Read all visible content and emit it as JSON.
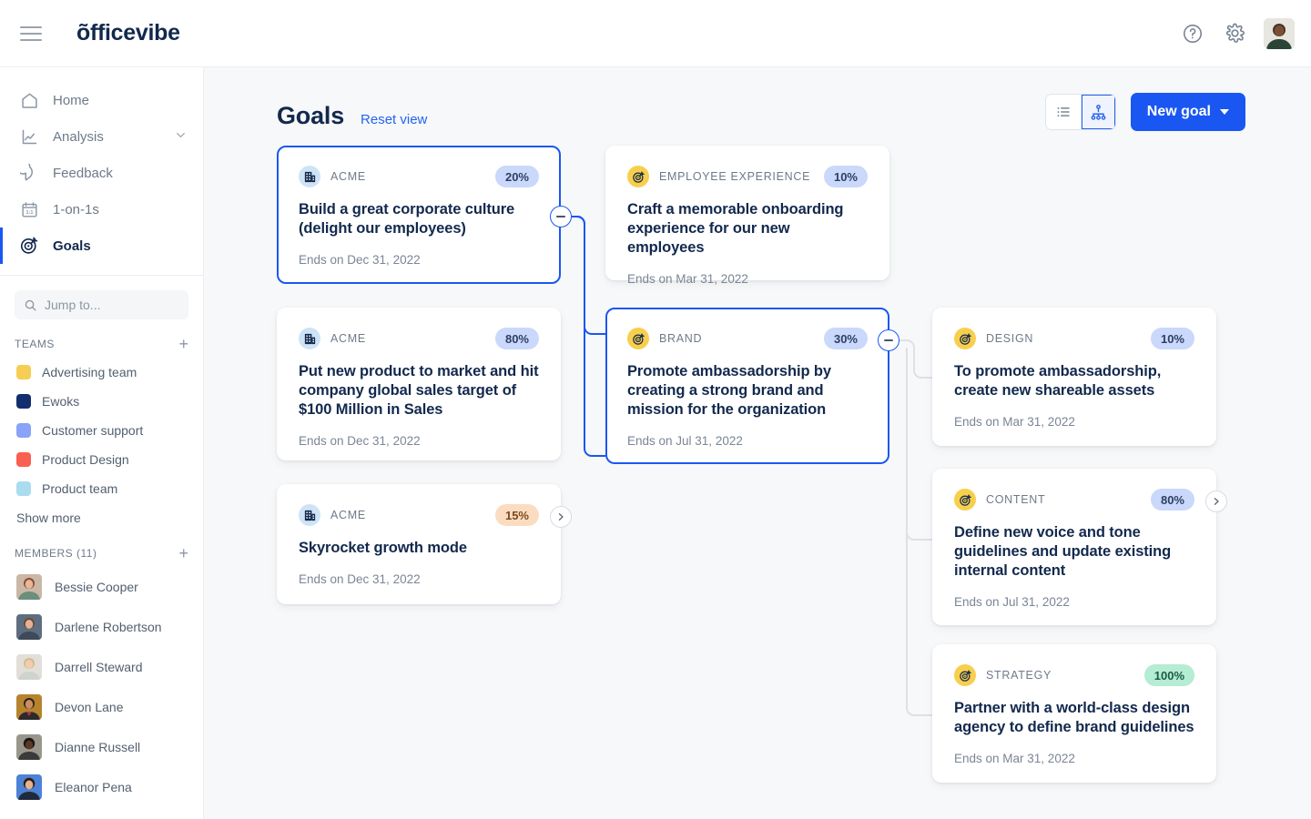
{
  "topbar": {
    "logo": "õfficevibe",
    "menu_icon": "hamburger-icon",
    "help_icon": "help-circle-icon",
    "settings_icon": "gear-icon",
    "avatar_label": "account-avatar"
  },
  "sidebar": {
    "nav": [
      {
        "label": "Home",
        "icon": "home-icon",
        "active": false,
        "chevron": false
      },
      {
        "label": "Analysis",
        "icon": "chart-line-icon",
        "active": false,
        "chevron": true
      },
      {
        "label": "Feedback",
        "icon": "speech-bubble-icon",
        "active": false,
        "chevron": false
      },
      {
        "label": "1-on-1s",
        "icon": "calendar-1on1-icon",
        "active": false,
        "chevron": false
      },
      {
        "label": "Goals",
        "icon": "target-icon",
        "active": true,
        "chevron": false
      }
    ],
    "search": {
      "placeholder": "Jump to...",
      "value": "",
      "icon": "search-icon"
    },
    "teams_header": {
      "title": "TEAMS",
      "add_icon": "plus-icon"
    },
    "teams": [
      {
        "label": "Advertising team",
        "color": "#f6ce56"
      },
      {
        "label": "Ewoks",
        "color": "#132e6e"
      },
      {
        "label": "Customer support",
        "color": "#8aa2f7"
      },
      {
        "label": "Product Design",
        "color": "#f9604f"
      },
      {
        "label": "Product team",
        "color": "#aadcf0"
      }
    ],
    "show_more": "Show more",
    "members_header": {
      "title": "MEMBERS (11)",
      "add_icon": "plus-icon"
    },
    "members": [
      {
        "name": "Bessie Cooper",
        "avatar_color": "#d8a48a"
      },
      {
        "name": "Darlene Robertson",
        "avatar_color": "#6e7f96"
      },
      {
        "name": "Darrell Steward",
        "avatar_color": "#d9d4cc"
      },
      {
        "name": "Devon Lane",
        "avatar_color": "#b8802f"
      },
      {
        "name": "Dianne Russell",
        "avatar_color": "#8b8378"
      },
      {
        "name": "Eleanor Pena",
        "avatar_color": "#4a7fd4"
      }
    ]
  },
  "page": {
    "title": "Goals",
    "reset_view": "Reset view",
    "view_list_icon": "list-view-icon",
    "view_tree_icon": "tree-view-icon",
    "active_view": "tree",
    "new_goal": "New goal"
  },
  "colors": {
    "accent": "#1a57f2",
    "link": "#2563f0",
    "badge_blue": "#c9d8fb",
    "badge_orange": "#fcdcc0",
    "badge_green": "#b4ecd4",
    "connector_blue": "#1a57f2",
    "connector_gray": "#dde1e6",
    "canvas_bg": "#f7f8f9"
  },
  "goals": [
    {
      "id": "corporate-culture",
      "org": "ACME",
      "org_icon": "building-icon",
      "percent": "20%",
      "percent_style": "blue",
      "title": "Build a great corporate culture (delight our employees)",
      "date": "Ends on Dec 31, 2022",
      "selected": true,
      "node": "minus"
    },
    {
      "id": "onboarding-experience",
      "org": "EMPLOYEE EXPERIENCE",
      "org_icon": "target-icon",
      "percent": "10%",
      "percent_style": "blue",
      "title": "Craft a memorable onboarding experience for our new employees",
      "date": "Ends on Mar 31, 2022",
      "selected": false,
      "node": "none"
    },
    {
      "id": "product-to-market",
      "org": "ACME",
      "org_icon": "building-icon",
      "percent": "80%",
      "percent_style": "blue",
      "title": "Put new product to market and hit company global sales target of $100 Million in Sales",
      "date": "Ends on Dec 31, 2022",
      "selected": false,
      "node": "none"
    },
    {
      "id": "promote-ambassadorship",
      "org": "BRAND",
      "org_icon": "target-icon",
      "percent": "30%",
      "percent_style": "blue",
      "title": "Promote ambassadorship by creating a strong brand and mission for the organization",
      "date": "Ends on Jul 31, 2022",
      "selected": true,
      "node": "minus"
    },
    {
      "id": "shareable-assets",
      "org": "DESIGN",
      "org_icon": "target-icon",
      "percent": "10%",
      "percent_style": "blue",
      "title": "To promote ambassadorship, create new shareable assets",
      "date": "Ends on Mar 31, 2022",
      "selected": false,
      "node": "none"
    },
    {
      "id": "skyrocket-growth",
      "org": "ACME",
      "org_icon": "building-icon",
      "percent": "15%",
      "percent_style": "orange",
      "title": "Skyrocket growth mode",
      "date": "Ends on Dec 31, 2022",
      "selected": false,
      "node": "plus"
    },
    {
      "id": "voice-and-tone",
      "org": "CONTENT",
      "org_icon": "target-icon",
      "percent": "80%",
      "percent_style": "blue",
      "title": "Define new voice and tone guidelines and update existing internal content",
      "date": "Ends on Jul 31, 2022",
      "selected": false,
      "node": "plus"
    },
    {
      "id": "brand-guidelines",
      "org": "STRATEGY",
      "org_icon": "target-icon",
      "percent": "100%",
      "percent_style": "green",
      "title": "Partner with a world-class design agency to define brand guidelines",
      "date": "Ends on Mar 31, 2022",
      "selected": false,
      "node": "none"
    }
  ]
}
